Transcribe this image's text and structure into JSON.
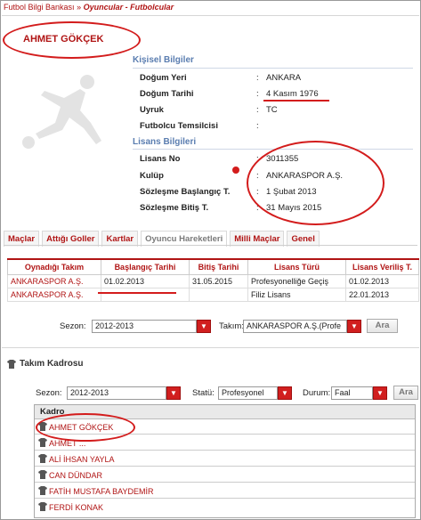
{
  "breadcrumb": {
    "root": "Futbol Bilgi Bankası",
    "sep": "»",
    "current": "Oyuncular - Futbolcular"
  },
  "player": {
    "name": "AHMET GÖKÇEK"
  },
  "personal": {
    "title": "Kişisel Bilgiler",
    "fields": [
      {
        "label": "Doğum Yeri",
        "value": "ANKARA"
      },
      {
        "label": "Doğum Tarihi",
        "value": "4 Kasım 1976"
      },
      {
        "label": "Uyruk",
        "value": "TC"
      },
      {
        "label": "Futbolcu Temsilcisi",
        "value": ""
      }
    ]
  },
  "license": {
    "title": "Lisans Bilgileri",
    "fields": [
      {
        "label": "Lisans No",
        "value": "3011355"
      },
      {
        "label": "Kulüp",
        "value": "ANKARASPOR A.Ş."
      },
      {
        "label": "Sözleşme Başlangıç T.",
        "value": "1 Şubat 2013"
      },
      {
        "label": "Sözleşme Bitiş T.",
        "value": "31 Mayıs 2015"
      }
    ]
  },
  "tabs": [
    "Maçlar",
    "Attığı Goller",
    "Kartlar",
    "Oyuncu Hareketleri",
    "Milli Maçlar",
    "Genel"
  ],
  "history": {
    "headers": [
      "Oynadığı Takım",
      "Başlangıç Tarihi",
      "Bitiş Tarihi",
      "Lisans Türü",
      "Lisans Veriliş T."
    ],
    "rows": [
      [
        "ANKARASPOR A.Ş.",
        "01.02.2013",
        "31.05.2015",
        "Profesyonelliğe Geçiş",
        "01.02.2013"
      ],
      [
        "ANKARASPOR A.Ş.",
        "",
        "",
        "Filiz Lisans",
        "22.01.2013"
      ]
    ]
  },
  "filter1": {
    "season_label": "Sezon:",
    "season_value": "2012-2013",
    "team_label": "Takım:",
    "team_value": "ANKARASPOR A.Ş.(Profe",
    "button": "Ara"
  },
  "squad": {
    "title": "Takım Kadrosu",
    "season_label": "Sezon:",
    "season_value": "2012-2013",
    "status_label": "Statü:",
    "status_value": "Profesyonel",
    "state_label": "Durum:",
    "state_value": "Faal",
    "button": "Ara",
    "list_header": "Kadro",
    "players": [
      "AHMET GÖKÇEK",
      "AHMET ... ",
      "ALİ İHSAN YAYLA",
      "CAN DÜNDAR",
      "FATİH MUSTAFA BAYDEMİR",
      "FERDİ KONAK"
    ]
  },
  "colors": {
    "accent": "#b01414",
    "section": "#5a7db0",
    "annotation": "#d31c1c"
  },
  "icons": [
    "shirt-icon",
    "dropdown-arrow-icon"
  ]
}
